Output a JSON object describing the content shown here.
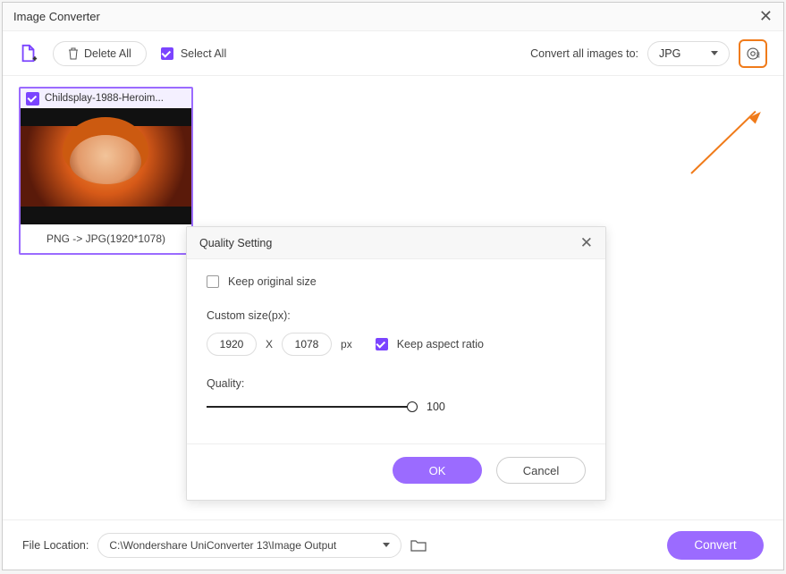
{
  "window": {
    "title": "Image Converter"
  },
  "toolbar": {
    "delete_all": "Delete All",
    "select_all": "Select All",
    "convert_all_label": "Convert all images to:",
    "format_selected": "JPG"
  },
  "thumbnail": {
    "filename": "Childsplay-1988-Heroim...",
    "caption": "PNG -> JPG(1920*1078)"
  },
  "dialog": {
    "title": "Quality Setting",
    "keep_original_label": "Keep original size",
    "custom_size_label": "Custom size(px):",
    "width_value": "1920",
    "times": "X",
    "height_value": "1078",
    "unit": "px",
    "keep_aspect_label": "Keep aspect ratio",
    "quality_label": "Quality:",
    "quality_value": "100",
    "ok": "OK",
    "cancel": "Cancel"
  },
  "footer": {
    "location_label": "File Location:",
    "location_path": "C:\\Wondershare UniConverter 13\\Image Output",
    "convert": "Convert"
  }
}
